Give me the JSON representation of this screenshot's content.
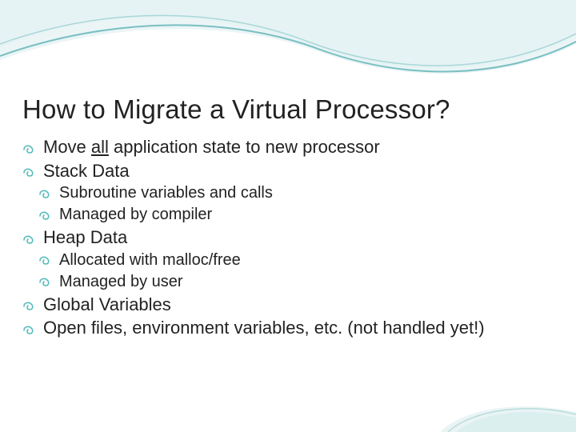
{
  "slide": {
    "title": "How to Migrate a Virtual Processor?",
    "items": [
      {
        "level": 1,
        "prefix": "Move ",
        "underlined": "all",
        "suffix": " application state to new processor"
      },
      {
        "level": 1,
        "text": "Stack Data"
      },
      {
        "level": 2,
        "text": "Subroutine variables and calls"
      },
      {
        "level": 2,
        "text": "Managed by compiler"
      },
      {
        "level": 1,
        "text": "Heap Data"
      },
      {
        "level": 2,
        "text": "Allocated with malloc/free"
      },
      {
        "level": 2,
        "text": "Managed by user"
      },
      {
        "level": 1,
        "text": "Global Variables"
      },
      {
        "level": 1,
        "text": "Open files, environment variables, etc. (not handled yet!)"
      }
    ]
  },
  "theme": {
    "accent": "#5bbcbc",
    "wave_light": "#cfe8ea",
    "wave_line": "#6fb9bc",
    "bg": "#ffffff"
  }
}
